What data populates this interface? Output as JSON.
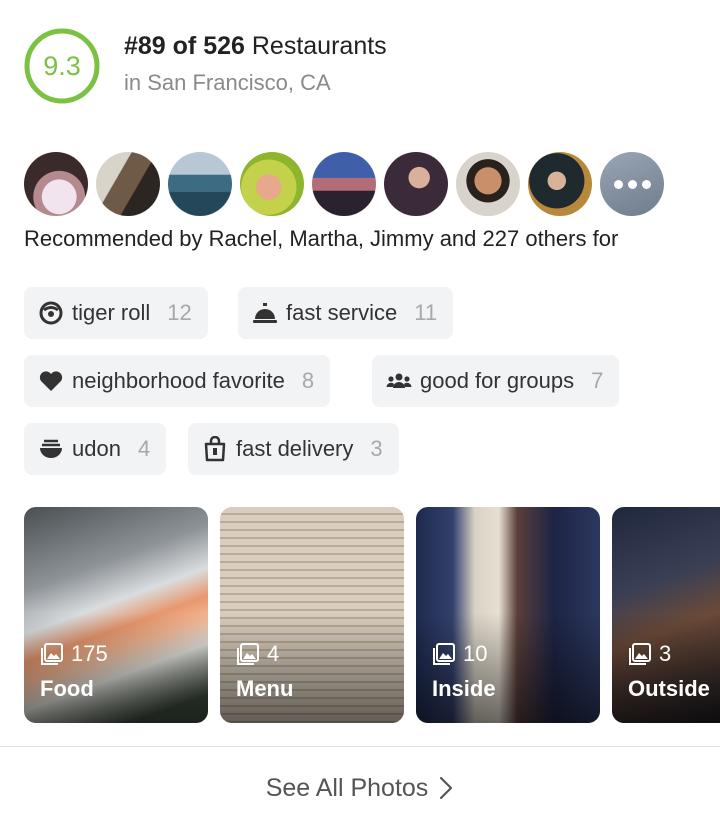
{
  "score": {
    "value": "9.3",
    "color": "#7cc242"
  },
  "ranking": {
    "rank": "#89 of 526",
    "suffix": "Restaurants",
    "location": "in San Francisco, CA"
  },
  "recommenders": {
    "avatars": [
      "avatar-1",
      "avatar-2",
      "avatar-3",
      "avatar-4",
      "avatar-5",
      "avatar-6",
      "avatar-7",
      "avatar-8"
    ],
    "more_icon": "ellipsis-icon",
    "text": "Recommended by Rachel, Martha, Jimmy and 227 others for"
  },
  "tags": [
    {
      "label": "tiger roll",
      "count": "12",
      "icon": "sushi-icon"
    },
    {
      "label": "fast service",
      "count": "11",
      "icon": "service-bell-icon"
    },
    {
      "label": "neighborhood favorite",
      "count": "8",
      "icon": "heart-icon"
    },
    {
      "label": "good for groups",
      "count": "7",
      "icon": "group-icon"
    },
    {
      "label": "udon",
      "count": "4",
      "icon": "noodle-bowl-icon"
    },
    {
      "label": "fast delivery",
      "count": "3",
      "icon": "takeout-bag-icon"
    }
  ],
  "photos": [
    {
      "count": "175",
      "category": "Food"
    },
    {
      "count": "4",
      "category": "Menu"
    },
    {
      "count": "10",
      "category": "Inside"
    },
    {
      "count": "3",
      "category": "Outside"
    }
  ],
  "see_all": {
    "label": "See All Photos",
    "icon": "chevron-right-icon"
  }
}
